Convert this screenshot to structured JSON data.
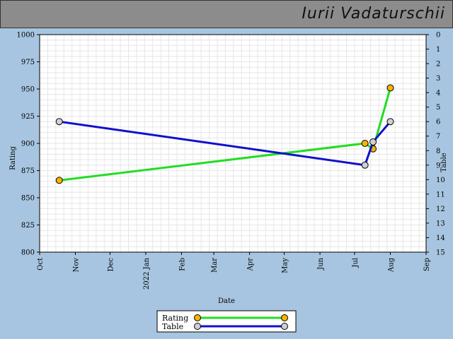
{
  "header": {
    "player_name": "Iurii Vadaturschii"
  },
  "chart_data": {
    "type": "line",
    "xlabel": "Date",
    "ylabel_left": "Rating",
    "ylabel_right": "Table",
    "x_ticks": [
      "Oct",
      "Nov",
      "Dec",
      "2022 Jan",
      "Feb",
      "Mar",
      "Apr",
      "May",
      "Jun",
      "Jul",
      "Aug",
      "Sep"
    ],
    "x_tick_dates": [
      "2021-10-01",
      "2021-11-01",
      "2021-12-01",
      "2022-01-01",
      "2022-02-01",
      "2022-03-01",
      "2022-04-01",
      "2022-05-01",
      "2022-06-01",
      "2022-07-01",
      "2022-08-01",
      "2022-09-01"
    ],
    "x_range": [
      "2021-10-01",
      "2022-09-01"
    ],
    "ylim_left": [
      800,
      1000
    ],
    "yticks_left": [
      800,
      825,
      850,
      875,
      900,
      925,
      950,
      975,
      1000
    ],
    "ylim_right": [
      15,
      0
    ],
    "yticks_right": [
      0,
      1,
      2,
      3,
      4,
      5,
      6,
      7,
      8,
      9,
      10,
      11,
      12,
      13,
      14,
      15
    ],
    "grid": true,
    "legend_position": "bottom",
    "series": [
      {
        "name": "Rating",
        "axis": "left",
        "line_color": "#22dd22",
        "marker_color": "#f5b400",
        "points": [
          {
            "x": "2021-10-18",
            "y": 866
          },
          {
            "x": "2022-07-10",
            "y": 900
          },
          {
            "x": "2022-07-17",
            "y": 895
          },
          {
            "x": "2022-08-01",
            "y": 951
          }
        ]
      },
      {
        "name": "Table",
        "axis": "right",
        "line_color": "#1010cc",
        "marker_color": "#d0d0d0",
        "points": [
          {
            "x": "2021-10-18",
            "y": 6
          },
          {
            "x": "2022-07-10",
            "y": 9
          },
          {
            "x": "2022-07-17",
            "y": 7.4
          },
          {
            "x": "2022-08-01",
            "y": 6
          }
        ]
      }
    ]
  }
}
